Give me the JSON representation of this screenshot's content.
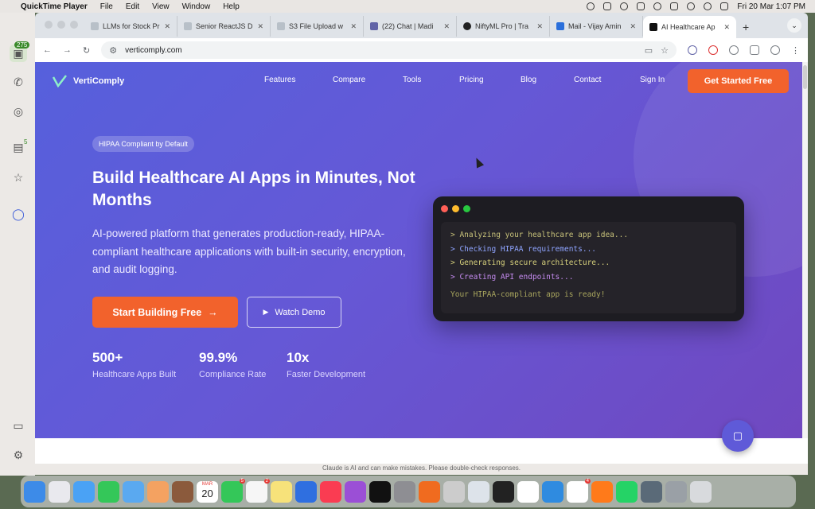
{
  "menubar": {
    "app": "QuickTime Player",
    "menus": [
      "File",
      "Edit",
      "View",
      "Window",
      "Help"
    ],
    "datetime": "Fri 20 Mar  1:07 PM"
  },
  "sidebar": {
    "badge": "275",
    "count": "5"
  },
  "tabs": [
    {
      "title": "LLMs for Stock Pr"
    },
    {
      "title": "Senior ReactJS D"
    },
    {
      "title": "S3 File Upload w"
    },
    {
      "title": "(22) Chat | Madi"
    },
    {
      "title": "NiftyML Pro | Tra"
    },
    {
      "title": "Mail - Vijay Amin"
    },
    {
      "title": "AI Healthcare Ap"
    }
  ],
  "address": {
    "url": "verticomply.com"
  },
  "site": {
    "brand": "VertiComply",
    "nav": [
      "Features",
      "Compare",
      "Tools",
      "Pricing",
      "Blog",
      "Contact",
      "Sign In"
    ],
    "cta_top": "Get Started Free",
    "badge": "HIPAA Compliant by Default",
    "headline": "Build Healthcare AI Apps in Minutes, Not Months",
    "subheadline": "AI-powered platform that generates production-ready, HIPAA-compliant healthcare applications with built-in security, encryption, and audit logging.",
    "btn_start": "Start Building Free",
    "btn_demo": "Watch Demo",
    "stats": [
      {
        "value": "500+",
        "label": "Healthcare Apps Built"
      },
      {
        "value": "99.9%",
        "label": "Compliance Rate"
      },
      {
        "value": "10x",
        "label": "Faster Development"
      }
    ],
    "terminal": {
      "lines": [
        {
          "text": "> Analyzing your healthcare app idea...",
          "color": "#c8c27a"
        },
        {
          "text": "> Checking HIPAA requirements...",
          "color": "#8fa4ff"
        },
        {
          "text": "> Generating secure architecture...",
          "color": "#d6d07c"
        },
        {
          "text": "> Creating API endpoints...",
          "color": "#c58bf0"
        },
        {
          "text": "Your HIPAA-compliant app is ready!",
          "color": "#a9a65e"
        }
      ]
    }
  },
  "below_window": "Claude is AI and can make mistakes. Please double-check responses.",
  "dock": {
    "calendar_month": "MAR",
    "calendar_day": "20",
    "badge_facetime": "5",
    "badge_reminders": "2",
    "badge_slack": "4"
  },
  "colors": {
    "accent": "#f2622c",
    "gradient_start": "#5660dc",
    "gradient_end": "#7048c0"
  }
}
